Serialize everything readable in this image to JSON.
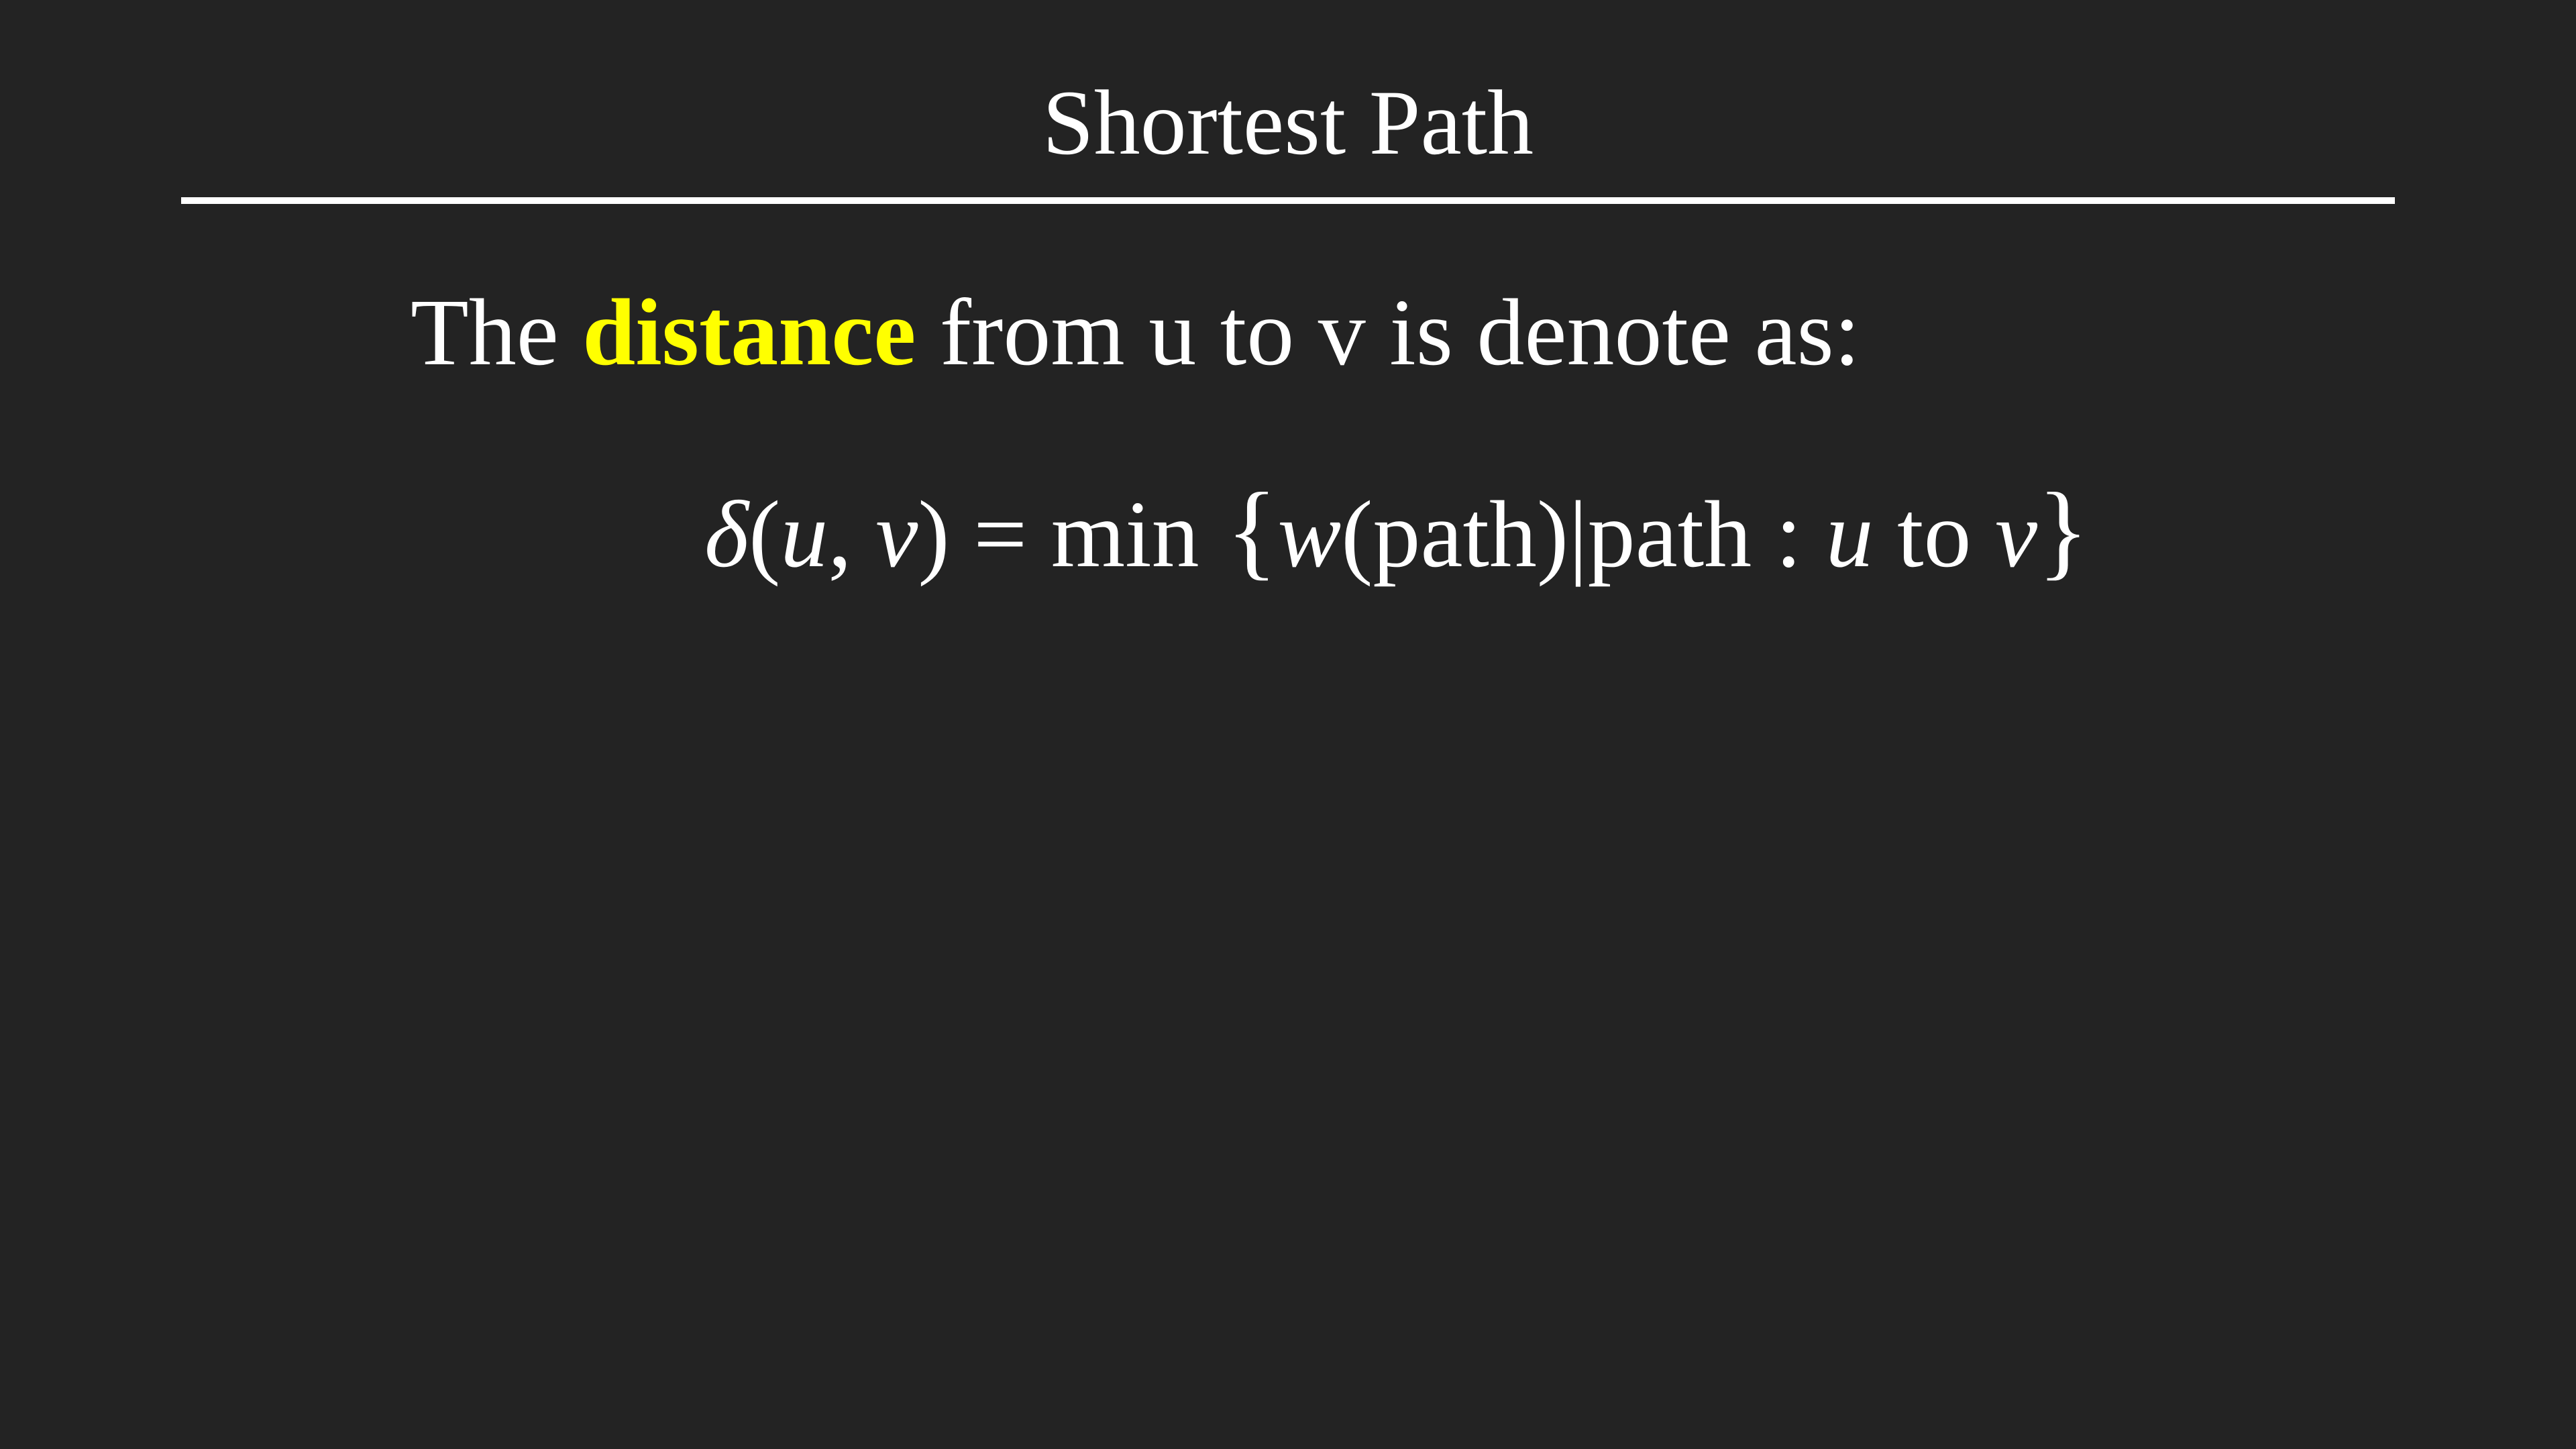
{
  "slide": {
    "title": "Shortest Path",
    "statement": {
      "before": "The ",
      "highlight": "distance",
      "after": " from u to v is denote as:"
    },
    "formula": {
      "delta": "δ",
      "args_open": "(",
      "arg_u": "u",
      "comma": ", ",
      "arg_v": "v",
      "args_close": ")",
      "equals": " = ",
      "min": "min",
      "brace_open": " {",
      "w": "w",
      "w_arg": "(path)",
      "bar": "|",
      "path": "path",
      "colon": " : ",
      "from": "u",
      "to": " to ",
      "dest": "v",
      "brace_close": "}"
    },
    "colors": {
      "background": "#232323",
      "text": "#ffffff",
      "highlight": "#ffff00"
    }
  }
}
